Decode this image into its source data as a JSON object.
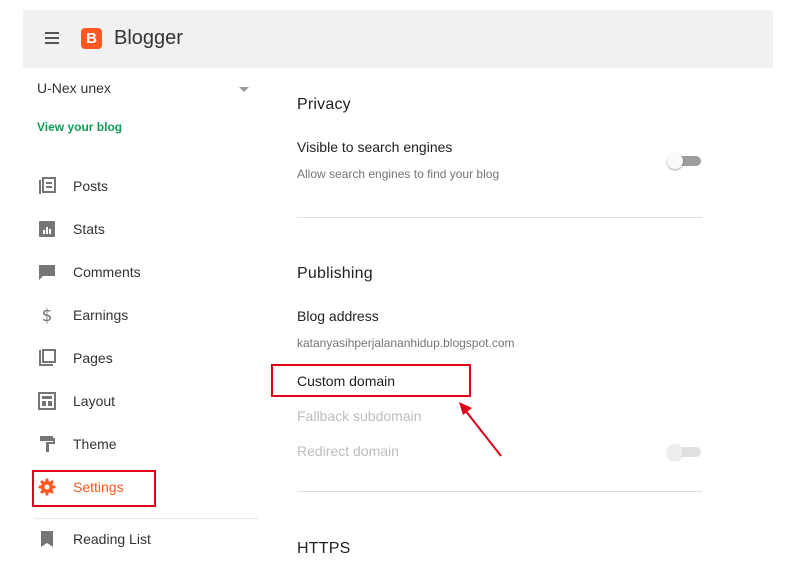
{
  "app": {
    "name": "Blogger",
    "logo_letter": "B",
    "brand_color": "#ff5722"
  },
  "blog": {
    "name": "U-Nex unex",
    "view_link": "View your blog"
  },
  "sidebar": {
    "items": [
      {
        "label": "Posts",
        "icon": "posts-icon"
      },
      {
        "label": "Stats",
        "icon": "stats-icon"
      },
      {
        "label": "Comments",
        "icon": "comments-icon"
      },
      {
        "label": "Earnings",
        "icon": "dollar-icon"
      },
      {
        "label": "Pages",
        "icon": "pages-icon"
      },
      {
        "label": "Layout",
        "icon": "layout-icon"
      },
      {
        "label": "Theme",
        "icon": "paint-roller-icon"
      },
      {
        "label": "Settings",
        "icon": "gear-icon",
        "active": true
      },
      {
        "label": "Reading List",
        "icon": "bookmark-icon"
      }
    ]
  },
  "privacy": {
    "title": "Privacy",
    "search_engines": {
      "label": "Visible to search engines",
      "description": "Allow search engines to find your blog",
      "enabled": false
    }
  },
  "publishing": {
    "title": "Publishing",
    "blog_address_label": "Blog address",
    "blog_address_value": "katanyasihperjalananhidup.blogspot.com",
    "custom_domain": "Custom domain",
    "fallback_subdomain": "Fallback subdomain",
    "redirect_domain": "Redirect domain",
    "redirect_enabled": false
  },
  "https": {
    "title": "HTTPS"
  },
  "colors": {
    "accent_green": "#0f9d58",
    "highlight_red": "#e0001b",
    "text": "#212121",
    "disabled": "#bdbdbd"
  }
}
